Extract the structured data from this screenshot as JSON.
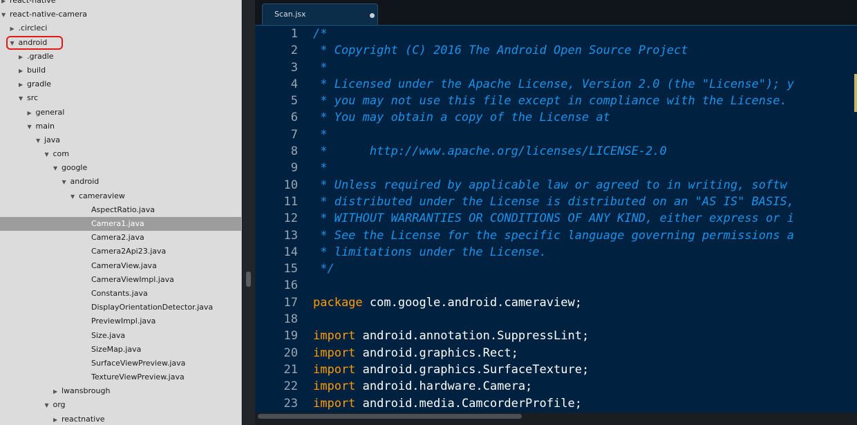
{
  "sidebar": {
    "items": [
      {
        "label": "react-native",
        "depth": 0,
        "arrow": "▶"
      },
      {
        "label": "react-native-camera",
        "depth": 0,
        "arrow": "▼"
      },
      {
        "label": ".circleci",
        "depth": 1,
        "arrow": "▶"
      },
      {
        "label": "android",
        "depth": 1,
        "arrow": "▼"
      },
      {
        "label": ".gradle",
        "depth": 2,
        "arrow": "▶"
      },
      {
        "label": "build",
        "depth": 2,
        "arrow": "▶"
      },
      {
        "label": "gradle",
        "depth": 2,
        "arrow": "▶"
      },
      {
        "label": "src",
        "depth": 2,
        "arrow": "▼"
      },
      {
        "label": "general",
        "depth": 3,
        "arrow": "▶"
      },
      {
        "label": "main",
        "depth": 3,
        "arrow": "▼"
      },
      {
        "label": "java",
        "depth": 4,
        "arrow": "▼"
      },
      {
        "label": "com",
        "depth": 5,
        "arrow": "▼"
      },
      {
        "label": "google",
        "depth": 6,
        "arrow": "▼"
      },
      {
        "label": "android",
        "depth": 7,
        "arrow": "▼"
      },
      {
        "label": "cameraview",
        "depth": 8,
        "arrow": "▼"
      },
      {
        "label": "AspectRatio.java",
        "depth": 9,
        "arrow": ""
      },
      {
        "label": "Camera1.java",
        "depth": 9,
        "arrow": "",
        "selected": true
      },
      {
        "label": "Camera2.java",
        "depth": 9,
        "arrow": ""
      },
      {
        "label": "Camera2Api23.java",
        "depth": 9,
        "arrow": ""
      },
      {
        "label": "CameraView.java",
        "depth": 9,
        "arrow": ""
      },
      {
        "label": "CameraViewImpl.java",
        "depth": 9,
        "arrow": ""
      },
      {
        "label": "Constants.java",
        "depth": 9,
        "arrow": ""
      },
      {
        "label": "DisplayOrientationDetector.java",
        "depth": 9,
        "arrow": ""
      },
      {
        "label": "PreviewImpl.java",
        "depth": 9,
        "arrow": ""
      },
      {
        "label": "Size.java",
        "depth": 9,
        "arrow": ""
      },
      {
        "label": "SizeMap.java",
        "depth": 9,
        "arrow": ""
      },
      {
        "label": "SurfaceViewPreview.java",
        "depth": 9,
        "arrow": ""
      },
      {
        "label": "TextureViewPreview.java",
        "depth": 9,
        "arrow": ""
      },
      {
        "label": "lwansbrough",
        "depth": 6,
        "arrow": "▶"
      },
      {
        "label": "org",
        "depth": 5,
        "arrow": "▼"
      },
      {
        "label": "reactnative",
        "depth": 6,
        "arrow": "▶"
      }
    ]
  },
  "editor": {
    "tab": {
      "label": "Scan.jsx"
    },
    "lines": [
      {
        "n": "1",
        "type": "comment",
        "text": "/*"
      },
      {
        "n": "2",
        "type": "comment",
        "text": " * Copyright (C) 2016 The Android Open Source Project"
      },
      {
        "n": "3",
        "type": "comment",
        "text": " *"
      },
      {
        "n": "4",
        "type": "comment",
        "text": " * Licensed under the Apache License, Version 2.0 (the \"License\"); y"
      },
      {
        "n": "5",
        "type": "comment",
        "text": " * you may not use this file except in compliance with the License."
      },
      {
        "n": "6",
        "type": "comment",
        "text": " * You may obtain a copy of the License at"
      },
      {
        "n": "7",
        "type": "comment",
        "text": " *"
      },
      {
        "n": "8",
        "type": "comment",
        "text": " *      http://www.apache.org/licenses/LICENSE-2.0"
      },
      {
        "n": "9",
        "type": "comment",
        "text": " *"
      },
      {
        "n": "10",
        "type": "comment",
        "text": " * Unless required by applicable law or agreed to in writing, softw"
      },
      {
        "n": "11",
        "type": "comment",
        "text": " * distributed under the License is distributed on an \"AS IS\" BASIS,"
      },
      {
        "n": "12",
        "type": "comment",
        "text": " * WITHOUT WARRANTIES OR CONDITIONS OF ANY KIND, either express or i"
      },
      {
        "n": "13",
        "type": "comment",
        "text": " * See the License for the specific language governing permissions a"
      },
      {
        "n": "14",
        "type": "comment",
        "text": " * limitations under the License."
      },
      {
        "n": "15",
        "type": "comment",
        "text": " */"
      },
      {
        "n": "16",
        "type": "blank",
        "text": ""
      },
      {
        "n": "17",
        "type": "code",
        "kw": "package",
        "rest": " com.google.android.cameraview;"
      },
      {
        "n": "18",
        "type": "blank",
        "text": ""
      },
      {
        "n": "19",
        "type": "code",
        "kw": "import",
        "rest": " android.annotation.SuppressLint;"
      },
      {
        "n": "20",
        "type": "code",
        "kw": "import",
        "rest": " android.graphics.Rect;"
      },
      {
        "n": "21",
        "type": "code",
        "kw": "import",
        "rest": " android.graphics.SurfaceTexture;"
      },
      {
        "n": "22",
        "type": "code",
        "kw": "import",
        "rest": " android.hardware.Camera;"
      },
      {
        "n": "23",
        "type": "code",
        "kw": "import",
        "rest": " android.media.CamcorderProfile;"
      }
    ]
  },
  "colors": {
    "comment": "#1b92ea",
    "keyword": "#ff9d00",
    "editor_bg": "#002240",
    "highlight_box": "#e01919"
  }
}
